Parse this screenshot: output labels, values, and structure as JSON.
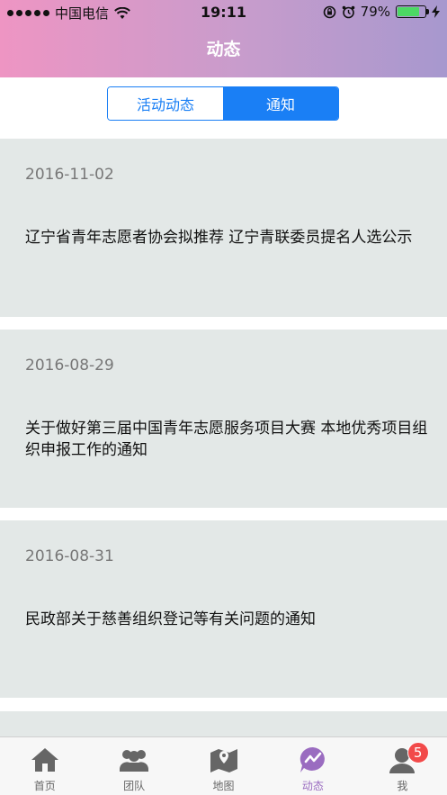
{
  "status_bar": {
    "carrier": "中国电信",
    "time": "19:11",
    "battery_percent": "79%",
    "battery_level": 0.79
  },
  "nav": {
    "title": "动态"
  },
  "segments": [
    {
      "label": "活动动态",
      "selected": false
    },
    {
      "label": "通知",
      "selected": true
    }
  ],
  "notices": [
    {
      "date": "2016-11-02",
      "title": "辽宁省青年志愿者协会拟推荐 辽宁青联委员提名人选公示"
    },
    {
      "date": "2016-08-29",
      "title": "关于做好第三届中国青年志愿服务项目大赛 本地优秀项目组织申报工作的通知"
    },
    {
      "date": "2016-08-31",
      "title": "民政部关于慈善组织登记等有关问题的通知"
    }
  ],
  "tabbar": {
    "items": [
      {
        "label": "首页",
        "icon": "home-icon"
      },
      {
        "label": "团队",
        "icon": "team-icon"
      },
      {
        "label": "地图",
        "icon": "map-icon"
      },
      {
        "label": "动态",
        "icon": "activity-icon",
        "active": true
      },
      {
        "label": "我",
        "icon": "profile-icon"
      }
    ],
    "me_badge": "5"
  },
  "colors": {
    "header_start": "#ee95c3",
    "header_end": "#a798ce",
    "accent_blue": "#1a7ff5",
    "active_tab": "#9a6cc0",
    "card_bg": "#e3e8e7",
    "badge": "#f24a4a"
  }
}
